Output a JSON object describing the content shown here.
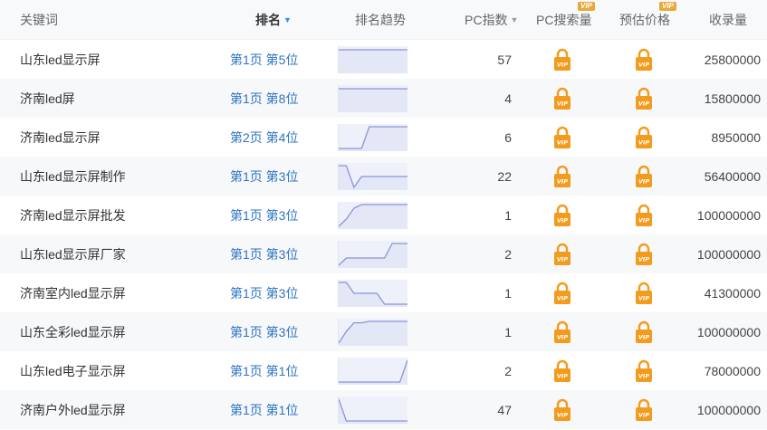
{
  "header": {
    "keyword": "关键词",
    "rank": "排名",
    "trend": "排名趋势",
    "pc_index": "PC指数",
    "pc_search": "PC搜索量",
    "est_price": "预估价格",
    "indexed": "收录量",
    "vip": "VIP"
  },
  "rows": [
    {
      "keyword": "山东led显示屏",
      "rank": "第1页 第5位",
      "index": "57",
      "count": "25800000",
      "trend": [
        1,
        1,
        1,
        1,
        1,
        1,
        1,
        1,
        1,
        1
      ]
    },
    {
      "keyword": "济南led屏",
      "rank": "第1页 第8位",
      "index": "4",
      "count": "15800000",
      "trend": [
        1,
        1,
        1,
        1,
        1,
        1,
        1,
        1,
        1,
        1
      ]
    },
    {
      "keyword": "济南led显示屏",
      "rank": "第2页 第4位",
      "index": "6",
      "count": "8950000",
      "trend": [
        2,
        2,
        2,
        2,
        1,
        1,
        1,
        1,
        1,
        1
      ]
    },
    {
      "keyword": "山东led显示屏制作",
      "rank": "第1页 第3位",
      "index": "22",
      "count": "56400000",
      "trend": [
        1,
        1,
        3,
        2,
        2,
        2,
        2,
        2,
        2,
        2
      ]
    },
    {
      "keyword": "济南led显示屏批发",
      "rank": "第1页 第3位",
      "index": "1",
      "count": "100000000",
      "trend": [
        8,
        6,
        3,
        2,
        2,
        2,
        2,
        2,
        2,
        2
      ]
    },
    {
      "keyword": "山东led显示屏厂家",
      "rank": "第1页 第3位",
      "index": "2",
      "count": "100000000",
      "trend": [
        8,
        6,
        6,
        6,
        6,
        6,
        6,
        2,
        2,
        2
      ]
    },
    {
      "keyword": "济南室内led显示屏",
      "rank": "第1页 第3位",
      "index": "1",
      "count": "41300000",
      "trend": [
        1,
        1,
        2,
        2,
        2,
        2,
        3,
        3,
        3,
        3
      ]
    },
    {
      "keyword": "山东全彩led显示屏",
      "rank": "第1页 第3位",
      "index": "1",
      "count": "100000000",
      "trend": [
        16,
        8,
        2,
        2,
        1,
        1,
        1,
        1,
        1,
        1
      ]
    },
    {
      "keyword": "山东led电子显示屏",
      "rank": "第1页 第1位",
      "index": "2",
      "count": "78000000",
      "trend": [
        12,
        12,
        12,
        12,
        12,
        12,
        12,
        12,
        12,
        1
      ]
    },
    {
      "keyword": "济南户外led显示屏",
      "rank": "第1页 第1位",
      "index": "47",
      "count": "100000000",
      "trend": [
        1,
        10,
        10,
        10,
        10,
        10,
        10,
        10,
        10,
        10
      ]
    }
  ],
  "colors": {
    "accent": "#2f74c2",
    "lock": "#f39b1c",
    "trend_line": "#8d94d6",
    "trend_bg": "#eef1fa"
  },
  "icons": {
    "search_cell": "vip-lock-icon",
    "price_cell": "vip-lock-icon"
  }
}
